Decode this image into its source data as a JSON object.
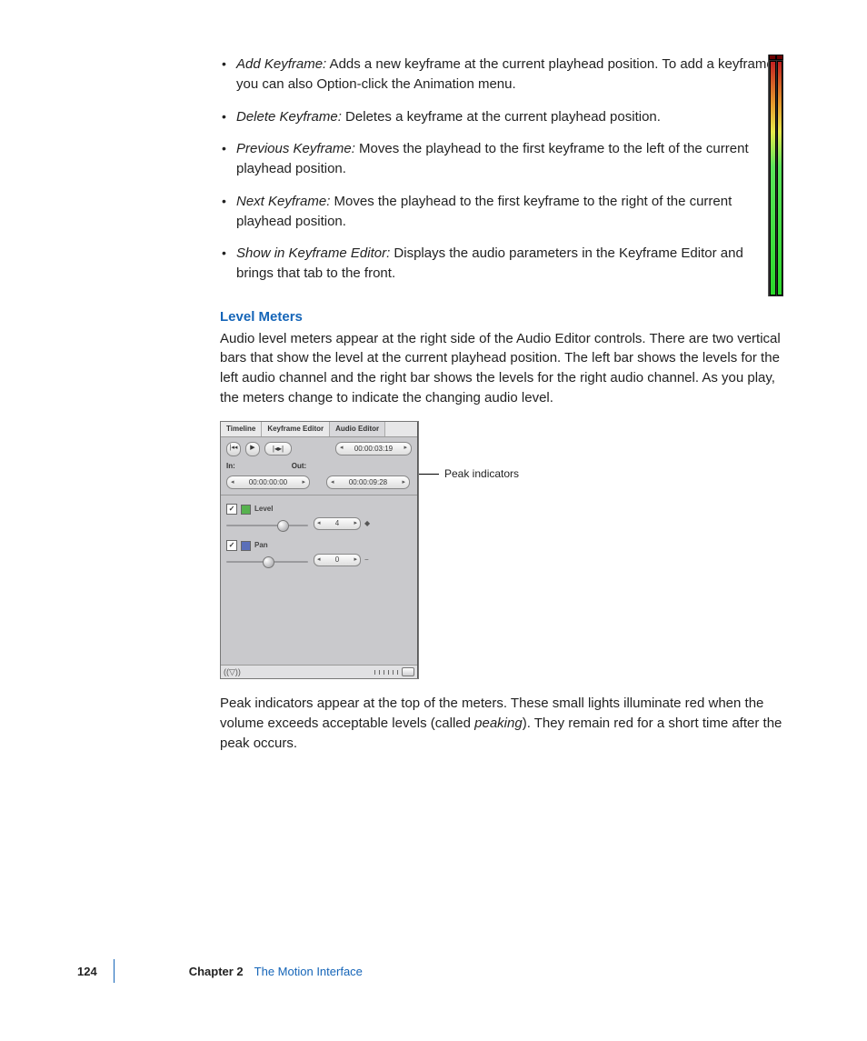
{
  "bullets": [
    {
      "term": "Add Keyframe:",
      "desc": " Adds a new keyframe at the current playhead position. To add a keyframe, you can also Option-click the Animation menu."
    },
    {
      "term": "Delete Keyframe:",
      "desc": " Deletes a keyframe at the current playhead position."
    },
    {
      "term": "Previous Keyframe:",
      "desc": " Moves the playhead to the first keyframe to the left of the current playhead position."
    },
    {
      "term": "Next Keyframe:",
      "desc": " Moves the playhead to the first keyframe to the right of the current playhead position."
    },
    {
      "term": "Show in Keyframe Editor:",
      "desc": " Displays the audio parameters in the Keyframe Editor and brings that tab to the front."
    }
  ],
  "section_heading": "Level Meters",
  "section_para": "Audio level meters appear at the right side of the Audio Editor controls. There are two vertical bars that show the level at the current playhead position. The left bar shows the levels for the left audio channel and the right bar shows the levels for the right audio channel. As you play, the meters change to indicate the changing audio level.",
  "callout": "Peak indicators",
  "after_para_pre": "Peak indicators appear at the top of the meters. These small lights illuminate red when the volume exceeds acceptable levels (called ",
  "after_para_em": "peaking",
  "after_para_post": "). They remain red for a short time after the peak occurs.",
  "tabs": {
    "timeline": "Timeline",
    "keyframe": "Keyframe Editor",
    "audio": "Audio Editor"
  },
  "transport": {
    "curtime": "00:00:03:19"
  },
  "in_label": "In:",
  "out_label": "Out:",
  "in_value": "00:00:00:00",
  "out_value": "00:00:09:28",
  "level_label": "Level",
  "level_value": "4",
  "pan_label": "Pan",
  "pan_value": "0",
  "footer": {
    "page": "124",
    "chapnum": "Chapter 2",
    "chaptitle": "The Motion Interface"
  }
}
